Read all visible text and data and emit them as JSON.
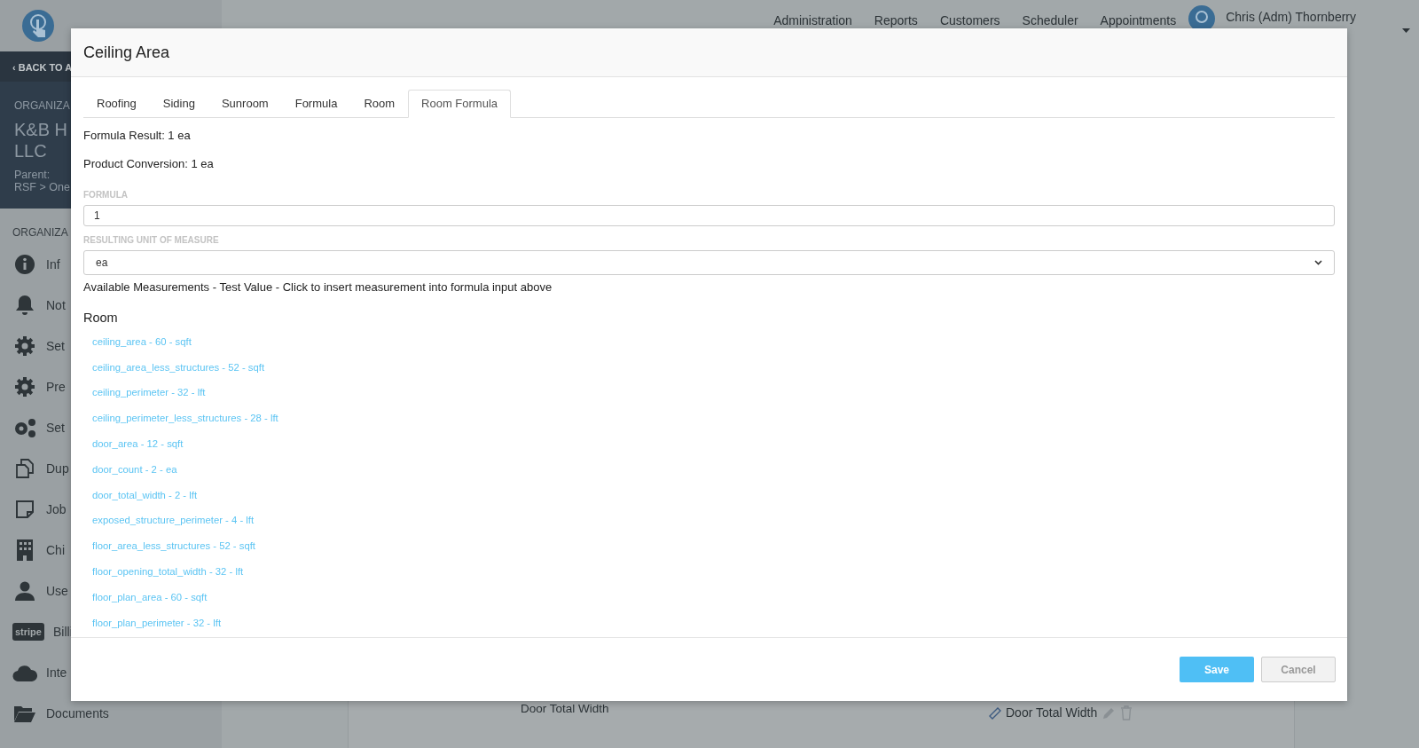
{
  "top_nav": {
    "items": [
      "Administration",
      "Reports",
      "Customers",
      "Scheduler",
      "Appointments"
    ],
    "user": "Chris (Adm) Thornberry"
  },
  "sidebar": {
    "back_link": "‹ BACK TO A",
    "org_heading": "ORGANIZA",
    "org_name": [
      "K&B H",
      "LLC"
    ],
    "parent": [
      "Parent:",
      "RSF > One"
    ],
    "section_heading": "ORGANIZA",
    "items": [
      {
        "label": "Inf"
      },
      {
        "label": "Not"
      },
      {
        "label": "Set"
      },
      {
        "label": "Pre"
      },
      {
        "label": "Set"
      },
      {
        "label": "Dup"
      },
      {
        "label": "Job"
      },
      {
        "label": "Chi"
      },
      {
        "label": "Use"
      },
      {
        "label": "Billi",
        "logo_text": "stripe"
      },
      {
        "label": "Inte"
      },
      {
        "label": "Documents"
      }
    ]
  },
  "background_row": {
    "name": "Door Total Width",
    "tag": "Door Total Width"
  },
  "modal": {
    "title": "Ceiling Area",
    "tabs": [
      {
        "label": "Roofing",
        "selected": false
      },
      {
        "label": "Siding",
        "selected": false
      },
      {
        "label": "Sunroom",
        "selected": false
      },
      {
        "label": "Formula",
        "selected": false
      },
      {
        "label": "Room",
        "selected": false
      },
      {
        "label": "Room Formula",
        "selected": true
      }
    ],
    "formula_result": "Formula Result: 1 ea",
    "product_conversion": "Product Conversion: 1 ea",
    "formula": {
      "label": "FORMULA",
      "value": "1"
    },
    "unit": {
      "label": "RESULTING UNIT OF MEASURE",
      "value": "ea"
    },
    "hint": "Available Measurements - Test Value - Click to insert measurement into formula input above",
    "section": "Room",
    "measurements": [
      "ceiling_area - 60 - sqft",
      "ceiling_area_less_structures - 52 - sqft",
      "ceiling_perimeter - 32 - lft",
      "ceiling_perimeter_less_structures - 28 - lft",
      "door_area - 12 - sqft",
      "door_count - 2 - ea",
      "door_total_width - 2 - lft",
      "exposed_structure_perimeter - 4 - lft",
      "floor_area_less_structures - 52 - sqft",
      "floor_opening_total_width - 32 - lft",
      "floor_plan_area - 60 - sqft",
      "floor_plan_perimeter - 32 - lft"
    ],
    "buttons": {
      "save": "Save",
      "cancel": "Cancel"
    }
  }
}
